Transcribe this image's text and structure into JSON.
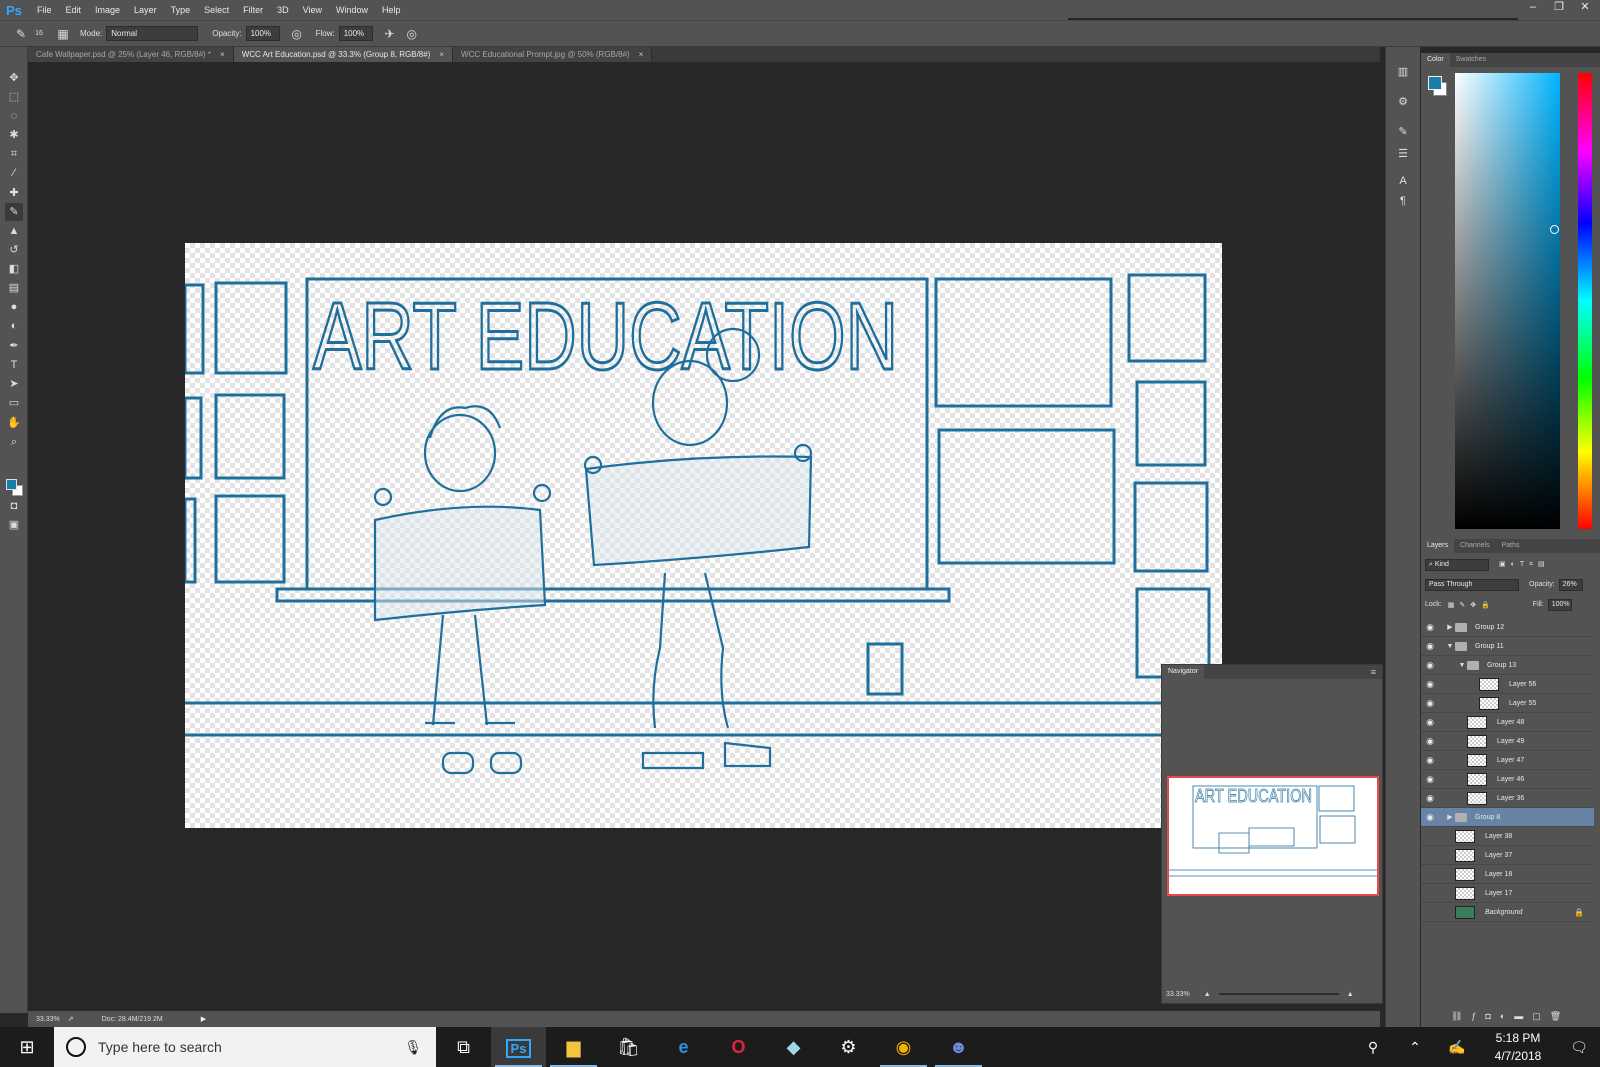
{
  "app": {
    "logo": "Ps",
    "menu": [
      "File",
      "Edit",
      "Image",
      "Layer",
      "Type",
      "Select",
      "Filter",
      "3D",
      "View",
      "Window",
      "Help"
    ]
  },
  "options": {
    "brush_size": "16",
    "mode_label": "Mode:",
    "mode_value": "Normal",
    "opacity_label": "Opacity:",
    "opacity_value": "100%",
    "flow_label": "Flow:",
    "flow_value": "100%"
  },
  "tabs": [
    {
      "label": "Cafe Wallpaper.psd @ 25% (Layer 46, RGB/8#) *",
      "active": false
    },
    {
      "label": "WCC Art Education.psd @ 33.3% (Group 8, RGB/8#)",
      "active": true
    },
    {
      "label": "WCC Educational Prompt.jpg @ 50% (RGB/8#)",
      "active": false
    }
  ],
  "canvas": {
    "title_text": "ART EDUCATION",
    "line_color": "#1f6f9c"
  },
  "status": {
    "zoom": "33.33%",
    "doc": "Doc: 28.4M/219.2M"
  },
  "color_panel": {
    "tabs": [
      "Color",
      "Swatches"
    ],
    "foreground": "#1a7fa8",
    "background": "#ffffff"
  },
  "layers_panel": {
    "tabs": [
      "Layers",
      "Channels",
      "Paths"
    ],
    "filter": "Kind",
    "blend_mode": "Pass Through",
    "opacity_label": "Opacity:",
    "opacity_value": "26%",
    "lock_label": "Lock:",
    "fill_label": "Fill:",
    "fill_value": "100%",
    "layers": [
      {
        "name": "Group 12",
        "type": "group",
        "expanded": false,
        "indent": 0,
        "visible": true,
        "selected": false
      },
      {
        "name": "Group 11",
        "type": "group",
        "expanded": true,
        "indent": 0,
        "visible": true,
        "selected": false
      },
      {
        "name": "Group 13",
        "type": "group",
        "expanded": true,
        "indent": 1,
        "visible": true,
        "selected": false
      },
      {
        "name": "Layer 56",
        "type": "layer",
        "indent": 2,
        "visible": true,
        "selected": false
      },
      {
        "name": "Layer 55",
        "type": "layer",
        "indent": 2,
        "visible": true,
        "selected": false
      },
      {
        "name": "Layer 48",
        "type": "layer",
        "indent": 1,
        "visible": true,
        "selected": false
      },
      {
        "name": "Layer 49",
        "type": "layer",
        "indent": 1,
        "visible": true,
        "selected": false
      },
      {
        "name": "Layer 47",
        "type": "layer",
        "indent": 1,
        "visible": true,
        "selected": false
      },
      {
        "name": "Layer 46",
        "type": "layer",
        "indent": 1,
        "visible": true,
        "selected": false
      },
      {
        "name": "Layer 36",
        "type": "layer",
        "indent": 1,
        "visible": true,
        "selected": false
      },
      {
        "name": "Group 8",
        "type": "group",
        "expanded": false,
        "indent": 0,
        "visible": true,
        "selected": true
      },
      {
        "name": "Layer 38",
        "type": "layer",
        "indent": 0,
        "visible": false,
        "selected": false
      },
      {
        "name": "Layer 37",
        "type": "layer",
        "indent": 0,
        "visible": false,
        "selected": false
      },
      {
        "name": "Layer 18",
        "type": "layer",
        "indent": 0,
        "visible": false,
        "selected": false
      },
      {
        "name": "Layer 17",
        "type": "layer",
        "indent": 0,
        "visible": false,
        "selected": false
      },
      {
        "name": "Background",
        "type": "background",
        "indent": 0,
        "visible": false,
        "selected": false
      }
    ]
  },
  "navigator": {
    "title": "Navigator",
    "zoom": "33.33%",
    "thumb_text": "ART EDUCATION"
  },
  "taskbar": {
    "search_placeholder": "Type here to search",
    "time": "5:18 PM",
    "date": "4/7/2018"
  }
}
